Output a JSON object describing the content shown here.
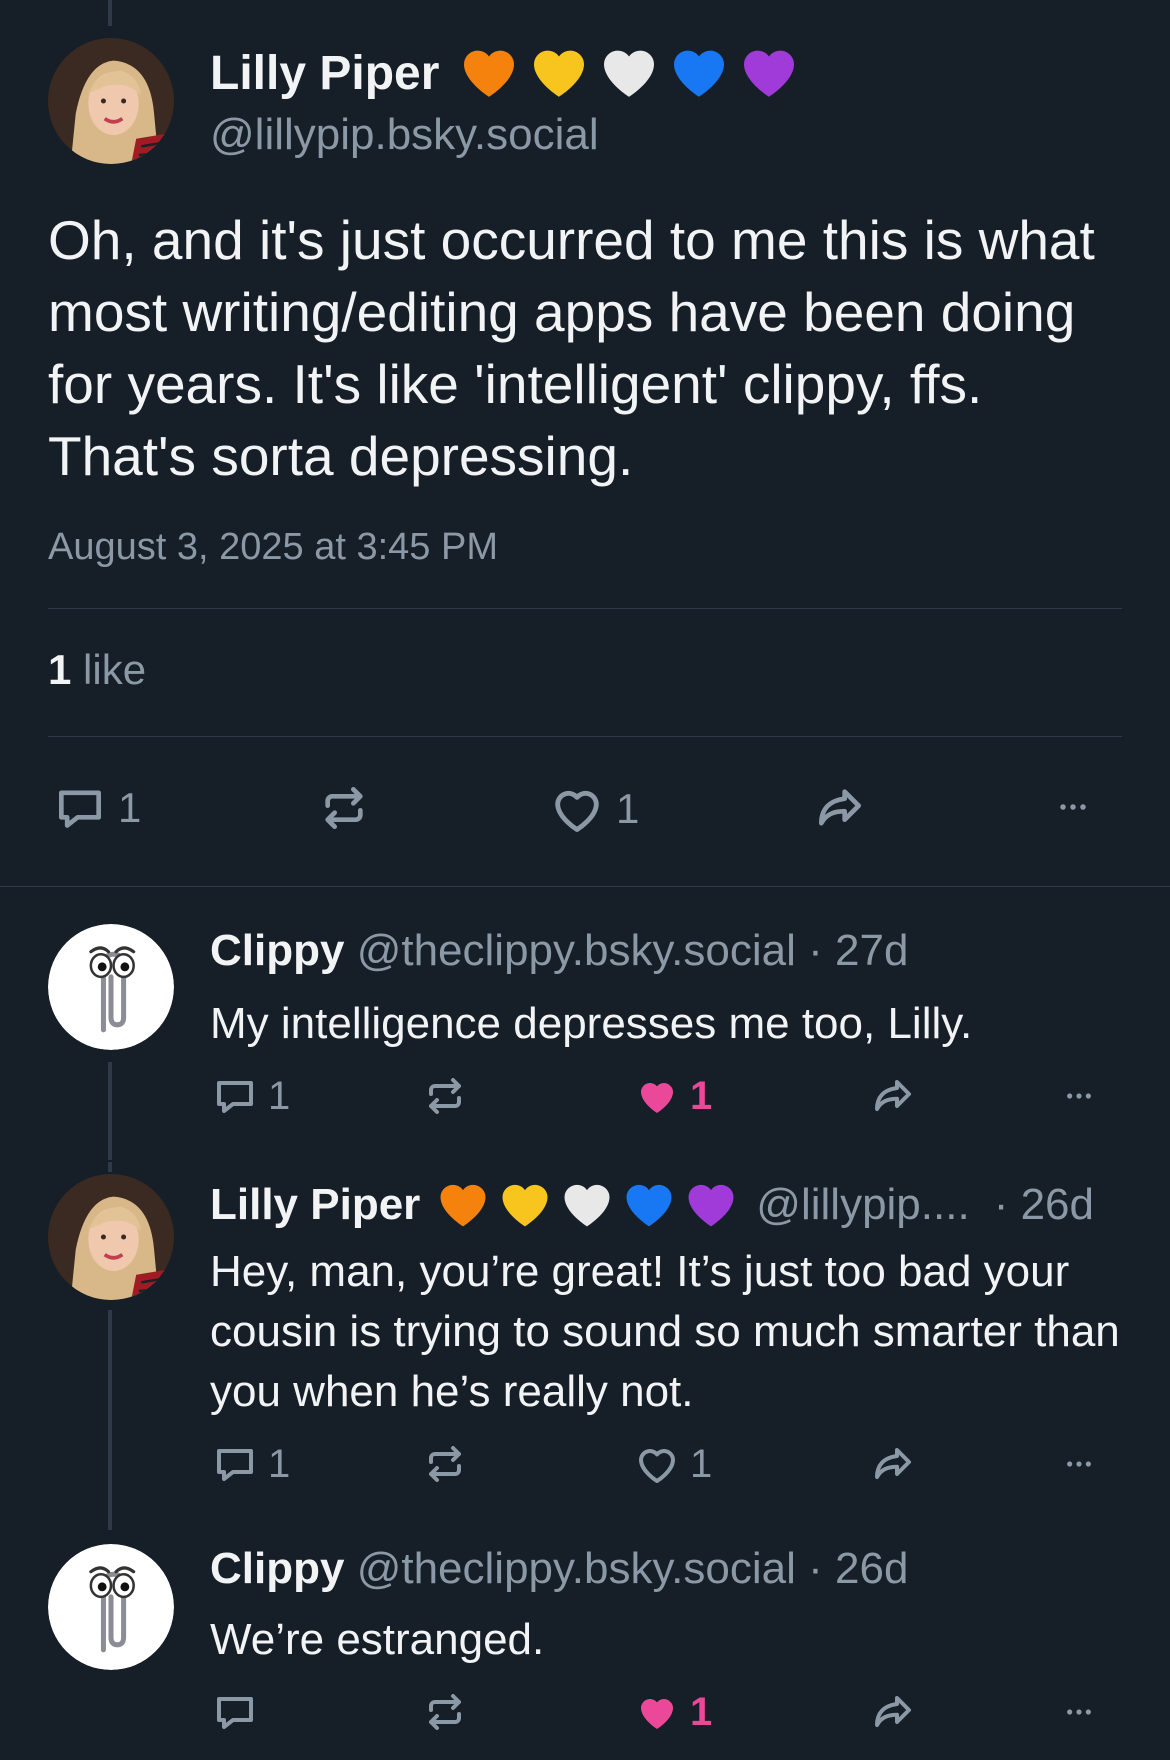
{
  "main_post": {
    "author": "Lilly Piper",
    "handle": "@lillypip.bsky.social",
    "text": "Oh, and it's just occurred to me this is what most writing/editing apps have been doing for years. It's like 'intelligent' clippy, ffs. That's sorta depressing.",
    "timestamp": "August 3, 2025 at 3:45 PM",
    "likes_count": "1",
    "likes_label": "like",
    "reply_count": "1",
    "like_count": "1"
  },
  "heart_colors": [
    "#f5820c",
    "#f7c51d",
    "#e8e8e8",
    "#1877f2",
    "#a03ad9"
  ],
  "replies": [
    {
      "author": "Clippy",
      "handle": "@theclippy.bsky.social",
      "age": "· 27d",
      "text": "My intelligence depresses me too, Lilly.",
      "reply_count": "1",
      "like_count": "1",
      "liked": true
    },
    {
      "author": "Lilly Piper",
      "handle": "@lillypip....",
      "age": "· 26d",
      "text": "Hey, man, you’re great! It’s just too bad your cousin is trying to sound so much smarter than you when he’s really not.",
      "reply_count": "1",
      "like_count": "1",
      "liked": false
    },
    {
      "author": "Clippy",
      "handle": "@theclippy.bsky.social",
      "age": "· 26d",
      "text": "We’re estranged.",
      "reply_count": "",
      "like_count": "1",
      "liked": true
    }
  ],
  "colors": {
    "background": "#161e27",
    "muted": "#8b98a5",
    "like_active": "#ec4899"
  }
}
